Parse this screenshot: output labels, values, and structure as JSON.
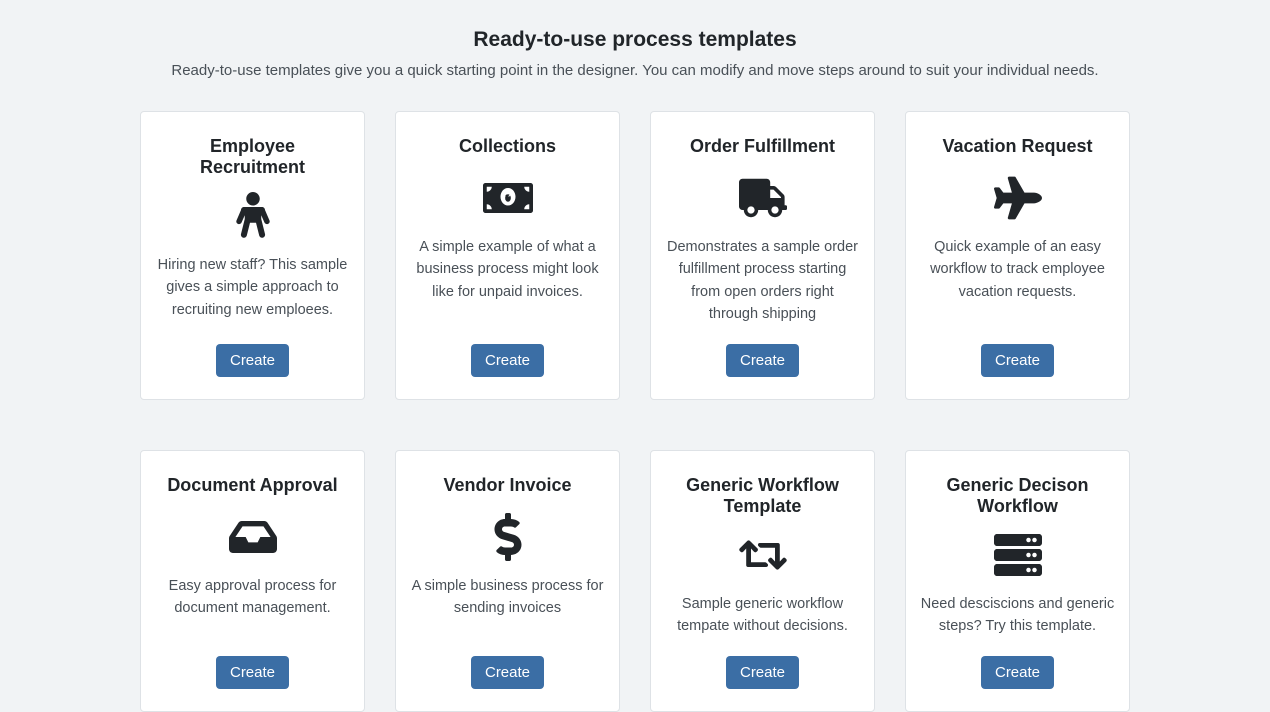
{
  "section": {
    "title": "Ready-to-use process templates",
    "subtitle": "Ready-to-use templates give you a quick starting point in the designer. You can modify and move steps around to suit your individual needs."
  },
  "create_label": "Create",
  "templates": [
    {
      "title": "Employee Recruitment",
      "desc": "Hiring new staff? This sample gives a simple approach to recruiting new emploees.",
      "icon": "person-icon"
    },
    {
      "title": "Collections",
      "desc": "A simple example of what a business process might look like for unpaid invoices.",
      "icon": "money-bill-icon"
    },
    {
      "title": "Order Fulfillment",
      "desc": "Demonstrates a sample order fulfillment process starting from open orders right through shipping",
      "icon": "truck-icon"
    },
    {
      "title": "Vacation Request",
      "desc": "Quick example of an easy workflow to track employee vacation requests.",
      "icon": "plane-icon"
    },
    {
      "title": "Document Approval",
      "desc": "Easy approval process for document management.",
      "icon": "inbox-icon"
    },
    {
      "title": "Vendor Invoice",
      "desc": "A simple business process for sending invoices",
      "icon": "dollar-icon"
    },
    {
      "title": "Generic Workflow Template",
      "desc": "Sample generic workflow tempate without decisions.",
      "icon": "retweet-icon"
    },
    {
      "title": "Generic Decison Workflow",
      "desc": "Need desciscions and generic steps? Try this template.",
      "icon": "server-icon"
    }
  ]
}
